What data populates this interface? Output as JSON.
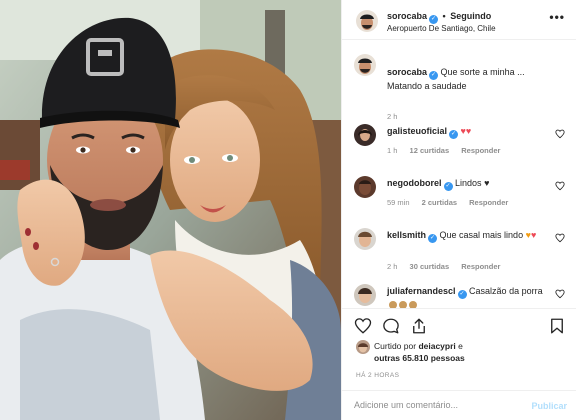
{
  "header": {
    "username": "sorocaba",
    "separator": "•",
    "follow_status": "Seguindo",
    "location": "Aeropuerto De Santiago, Chile",
    "more": "•••",
    "verified_glyph": "✓"
  },
  "caption": {
    "username": "sorocaba",
    "text": "Que sorte a minha ... Matando a saudade",
    "time": "2 h"
  },
  "comments": [
    {
      "username": "galisteuoficial",
      "text": "",
      "emoji": [
        "heart",
        "heart"
      ],
      "time": "1 h",
      "likes": "12 curtidas",
      "reply": "Responder"
    },
    {
      "username": "negodoborel",
      "text": "Lindos",
      "emoji": [
        "black-heart"
      ],
      "time": "59 min",
      "likes": "2 curtidas",
      "reply": "Responder"
    },
    {
      "username": "kellsmith",
      "text": "Que casal mais lindo",
      "emoji": [
        "orange-heart",
        "heart"
      ],
      "time": "2 h",
      "likes": "30 curtidas",
      "reply": "Responder"
    },
    {
      "username": "juliafernandescl",
      "text": "Casalzão da porra",
      "emoji": [
        "clap",
        "clap",
        "clap"
      ],
      "time": "",
      "likes": "",
      "reply": ""
    }
  ],
  "emoji_glyphs": {
    "heart": "♥",
    "black_heart": "♥"
  },
  "likes": {
    "prefix": "Curtido por",
    "user": "deiacypri",
    "middle": "e",
    "others": "outras 65.810 pessoas"
  },
  "time_ago": "HÁ 2 HORAS",
  "add_comment": {
    "placeholder": "Adicione um comentário...",
    "publish": "Publicar"
  },
  "icons": [
    "verified-badge",
    "more-icon",
    "like-heart-icon",
    "comment-icon",
    "share-icon",
    "save-icon"
  ],
  "colors": {
    "verified": "#3897f0",
    "heart": "#ed4956",
    "muted": "#8e8e8e",
    "publish_disabled": "#b2dffc"
  }
}
